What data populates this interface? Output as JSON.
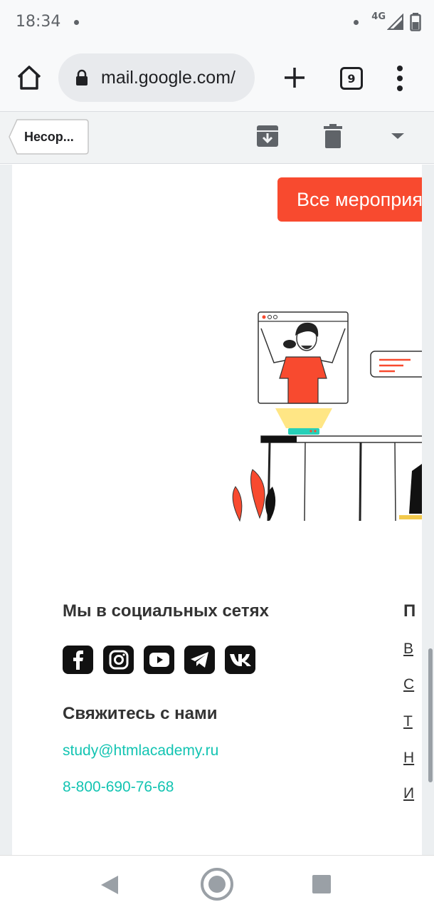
{
  "status_bar": {
    "time": "18:34",
    "network": "4G",
    "icons": [
      "notification-dot-icon",
      "signal-icon",
      "battery-icon"
    ]
  },
  "browser": {
    "url": "mail.google.com/",
    "tab_count": "9",
    "icons": [
      "home-icon",
      "lock-icon",
      "plus-icon",
      "tabs-icon",
      "more-vert-icon"
    ]
  },
  "gmail_toolbar": {
    "back_label": "Несор...",
    "icons": [
      "archive-icon",
      "delete-icon",
      "more-down-icon"
    ]
  },
  "email": {
    "events_button": "Все мероприятия",
    "social_title": "Мы в социальных сетях",
    "social_icons": [
      "facebook-icon",
      "instagram-icon",
      "youtube-icon",
      "telegram-icon",
      "vk-icon"
    ],
    "contact_title": "Свяжитесь с нами",
    "contact_email": "study@htmlacademy.ru",
    "contact_phone": "8-800-690-76-68",
    "right_column": {
      "title": "П",
      "links": [
        "В",
        "С",
        "Т",
        "Н",
        "И"
      ]
    },
    "colors": {
      "accent_red": "#f84a2f",
      "link_teal": "#13c4b2",
      "icon_dark": "#111111"
    }
  },
  "nav_bar": {
    "icons": [
      "back-triangle-icon",
      "home-circle-icon",
      "recents-square-icon"
    ]
  }
}
